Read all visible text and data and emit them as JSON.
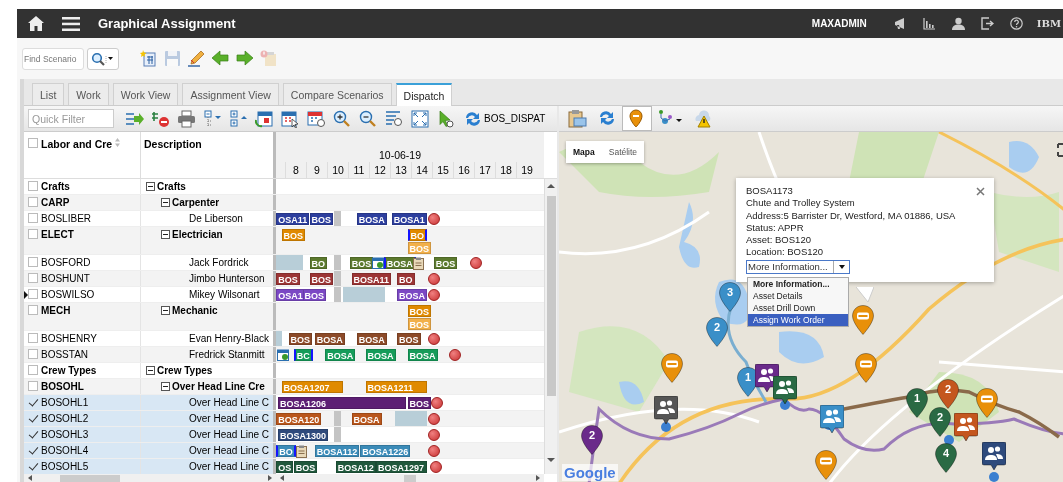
{
  "header": {
    "title": "Graphical Assignment",
    "user": "MAXADMIN",
    "logo": "IBM"
  },
  "toolbar": {
    "search": {
      "placeholder": "Find Scenario"
    },
    "actions": [
      {
        "kind": "new",
        "disabled": false
      },
      {
        "kind": "save",
        "disabled": true
      },
      {
        "kind": "edit",
        "disabled": false
      },
      {
        "kind": "back",
        "disabled": false
      },
      {
        "kind": "forward",
        "disabled": false
      },
      {
        "kind": "alert",
        "disabled": true
      }
    ]
  },
  "tabs": [
    {
      "label": "List",
      "selected": false
    },
    {
      "label": "Work",
      "selected": false
    },
    {
      "label": "Work View",
      "selected": false
    },
    {
      "label": "Assignment View",
      "selected": false
    },
    {
      "label": "Compare Scenarios",
      "selected": false
    },
    {
      "label": "Dispatch",
      "selected": true
    }
  ],
  "dispatch_toolbar": {
    "filter": {
      "placeholder": "Quick Filter"
    },
    "scenario": "BOS_DISPAT"
  },
  "map_toolbar": [
    {
      "kind": "clipboard",
      "selected": false
    },
    {
      "kind": "refresh",
      "selected": false
    },
    {
      "kind": "pin",
      "selected": true
    },
    {
      "kind": "crew",
      "selected": false
    },
    {
      "kind": "weather",
      "selected": false
    }
  ],
  "grid": {
    "all_checked": false,
    "columns": [
      "Labor and Cre",
      "Description"
    ],
    "date": "10-06-19",
    "hours": [
      "8",
      "9",
      "10",
      "11",
      "12",
      "13",
      "14",
      "15",
      "16",
      "17",
      "18",
      "19"
    ],
    "rows": [
      {
        "code": "Crafts",
        "description": "Crafts",
        "checked": false,
        "current": false,
        "expanded": true,
        "children": [
          {
            "code": "CARP",
            "description": "Carpenter",
            "checked": false,
            "current": false,
            "expanded": true,
            "children": [
              {
                "code": "BOSLIBER",
                "description": "De Liberson",
                "checked": false,
                "current": false,
                "bars": [
                  {
                    "kind": "work",
                    "label": "OSA11",
                    "color": "#2d3f9e",
                    "selected": false
                  },
                  {
                    "kind": "work",
                    "label": "BOS",
                    "color": "#2d3f9e",
                    "selected": false
                  },
                  {
                    "kind": "break"
                  },
                  {
                    "kind": "work",
                    "label": "BOSA",
                    "color": "#2d3f9e",
                    "selected": false
                  },
                  {
                    "kind": "work",
                    "label": "BOSA1",
                    "color": "#2d3f9e",
                    "selected": false
                  },
                  {
                    "kind": "alert"
                  }
                ]
              }
            ]
          },
          {
            "code": "ELECT",
            "description": "Electrician",
            "checked": false,
            "current": false,
            "expanded": true,
            "bars": [
              {
                "kind": "work",
                "label": "BOS",
                "color": "#e08a00",
                "selected": false
              },
              {
                "kind": "work",
                "label": "BO",
                "color": "#e08a00",
                "selected": true
              }
            ],
            "second_lane": [
              {
                "kind": "work",
                "label": "BOS",
                "color": "#f2b04a",
                "selected": false
              }
            ],
            "children": [
              {
                "code": "BOSFORD",
                "description": "Jack Fordrick",
                "checked": false,
                "current": false,
                "bars": [
                  {
                    "kind": "unavailable"
                  },
                  {
                    "kind": "work",
                    "label": "BO",
                    "color": "#5c7a2e",
                    "selected": false
                  },
                  {
                    "kind": "break"
                  },
                  {
                    "kind": "work",
                    "label": "BOS",
                    "color": "#5c7a2e",
                    "selected": false
                  },
                  {
                    "kind": "calendar"
                  },
                  {
                    "kind": "work",
                    "label": "BOSA",
                    "color": "#5c7a2e",
                    "selected": true
                  },
                  {
                    "kind": "note"
                  },
                  {
                    "kind": "work",
                    "label": "BOS",
                    "color": "#5c7a2e",
                    "selected": false
                  },
                  {
                    "kind": "alert"
                  }
                ]
              },
              {
                "code": "BOSHUNT",
                "description": "Jimbo Hunterson",
                "checked": false,
                "current": false,
                "bars": [
                  {
                    "kind": "work",
                    "label": "BOS",
                    "color": "#9c3535",
                    "selected": false
                  },
                  {
                    "kind": "work",
                    "label": "BOS",
                    "color": "#9c3535",
                    "selected": false
                  },
                  {
                    "kind": "break"
                  },
                  {
                    "kind": "work",
                    "label": "BOSA11",
                    "color": "#9c3535",
                    "selected": false
                  },
                  {
                    "kind": "work",
                    "label": "BO",
                    "color": "#9c3535",
                    "selected": false
                  },
                  {
                    "kind": "alert"
                  }
                ]
              },
              {
                "code": "BOSWILSO",
                "description": "Mikey Wilsonart",
                "checked": false,
                "current": true,
                "bars": [
                  {
                    "kind": "work",
                    "label": "OSA1",
                    "color": "#7b48c4",
                    "selected": false
                  },
                  {
                    "kind": "work",
                    "label": "BOS",
                    "color": "#7b48c4",
                    "selected": false
                  },
                  {
                    "kind": "break"
                  },
                  {
                    "kind": "unavailable"
                  },
                  {
                    "kind": "work",
                    "label": "BOSA",
                    "color": "#7b48c4",
                    "selected": false
                  },
                  {
                    "kind": "alert"
                  }
                ]
              }
            ]
          },
          {
            "code": "MECH",
            "description": "Mechanic",
            "checked": false,
            "current": false,
            "expanded": true,
            "bars": [
              {
                "kind": "work",
                "label": "BOS",
                "color": "#e08a00",
                "selected": false
              }
            ],
            "second_lane": [
              {
                "kind": "work",
                "label": "BOS",
                "color": "#f2b04a",
                "selected": false
              }
            ],
            "children": [
              {
                "code": "BOSHENRY",
                "description": "Evan Henry-Black",
                "checked": false,
                "current": false,
                "bars": [
                  {
                    "kind": "unavailable"
                  },
                  {
                    "kind": "work",
                    "label": "BOS",
                    "color": "#8c4a28",
                    "selected": false
                  },
                  {
                    "kind": "work",
                    "label": "BOSA",
                    "color": "#8c4a28",
                    "selected": false
                  },
                  {
                    "kind": "work",
                    "label": "BOSA",
                    "color": "#8c4a28",
                    "selected": false
                  },
                  {
                    "kind": "work",
                    "label": "BOS",
                    "color": "#8c4a28",
                    "selected": false
                  },
                  {
                    "kind": "alert"
                  }
                ]
              },
              {
                "code": "BOSSTAN",
                "description": "Fredrick Stanmitt",
                "checked": false,
                "current": false,
                "bars": [
                  {
                    "kind": "calendar"
                  },
                  {
                    "kind": "work",
                    "label": "BC",
                    "color": "#169c5a",
                    "selected": true
                  },
                  {
                    "kind": "work",
                    "label": "BOSA",
                    "color": "#169c5a",
                    "selected": false
                  },
                  {
                    "kind": "work",
                    "label": "BOSA",
                    "color": "#169c5a",
                    "selected": false
                  },
                  {
                    "kind": "work",
                    "label": "BOSA",
                    "color": "#169c5a",
                    "selected": false
                  },
                  {
                    "kind": "alert"
                  }
                ]
              }
            ]
          }
        ]
      },
      {
        "code": "Crew Types",
        "description": "Crew Types",
        "checked": false,
        "current": false,
        "expanded": true,
        "children": [
          {
            "code": "BOSOHL",
            "description": "Over Head Line Cre",
            "checked": false,
            "current": false,
            "expanded": true,
            "bars": [
              {
                "kind": "work",
                "label": "BOSA1207",
                "color": "#e08a00",
                "selected": false
              },
              {
                "kind": "work",
                "label": "BOSA1211",
                "color": "#e08a00",
                "selected": false
              }
            ],
            "children": [
              {
                "code": "BOSOHL1",
                "description": "Over Head Line C",
                "checked": true,
                "current": false,
                "bars": [
                  {
                    "kind": "work",
                    "label": "BOSA1206",
                    "color": "#5d1f74",
                    "selected": false
                  },
                  {
                    "kind": "work",
                    "label": "BOS",
                    "color": "#5d1f74",
                    "selected": false
                  },
                  {
                    "kind": "alert"
                  }
                ]
              },
              {
                "code": "BOSOHL2",
                "description": "Over Head Line C",
                "checked": true,
                "current": false,
                "bars": [
                  {
                    "kind": "work",
                    "label": "BOSA120",
                    "color": "#b9561c",
                    "selected": false
                  },
                  {
                    "kind": "break"
                  },
                  {
                    "kind": "work",
                    "label": "BOSA",
                    "color": "#b9561c",
                    "selected": false
                  },
                  {
                    "kind": "unavailable"
                  },
                  {
                    "kind": "alert"
                  }
                ]
              },
              {
                "code": "BOSOHL3",
                "description": "Over Head Line C",
                "checked": true,
                "current": false,
                "bars": [
                  {
                    "kind": "work",
                    "label": "BOSA1300",
                    "color": "#2e4a7c",
                    "selected": false
                  },
                  {
                    "kind": "break"
                  },
                  {
                    "kind": "alert"
                  }
                ]
              },
              {
                "code": "BOSOHL4",
                "description": "Over Head Line C",
                "checked": true,
                "current": false,
                "bars": [
                  {
                    "kind": "work",
                    "label": "BO",
                    "color": "#3b8bb8",
                    "selected": true
                  },
                  {
                    "kind": "note"
                  },
                  {
                    "kind": "work",
                    "label": "BOSA112",
                    "color": "#3b8bb8",
                    "selected": false
                  },
                  {
                    "kind": "work",
                    "label": "BOSA1226",
                    "color": "#3b8bb8",
                    "selected": false
                  },
                  {
                    "kind": "alert"
                  }
                ]
              },
              {
                "code": "BOSOHL5",
                "description": "Over Head Line C",
                "checked": true,
                "current": false,
                "bars": [
                  {
                    "kind": "work",
                    "label": "OS",
                    "color": "#20583c",
                    "selected": false
                  },
                  {
                    "kind": "work",
                    "label": "BOS",
                    "color": "#20583c",
                    "selected": false
                  },
                  {
                    "kind": "work",
                    "label": "BOSA12",
                    "color": "#20583c",
                    "selected": false
                  },
                  {
                    "kind": "work",
                    "label": "BOSA1297",
                    "color": "#20583c",
                    "selected": false
                  },
                  {
                    "kind": "alert"
                  }
                ]
              }
            ]
          }
        ]
      }
    ]
  },
  "map": {
    "types": [
      {
        "label": "Mapa",
        "selected": true
      },
      {
        "label": "Satélite",
        "selected": false
      }
    ],
    "popup": {
      "title": "BOSA1173",
      "lines": [
        "Chute and Trolley System",
        "Address:5 Barrister Dr, Westford, MA 01886, USA",
        "Status: APPR",
        "Asset: BOS120",
        "Location: BOS120"
      ],
      "dropdown": {
        "value": "More Information...",
        "options": [
          {
            "label": "More Information...",
            "selected": true,
            "highlighted": false
          },
          {
            "label": "Asset Details",
            "selected": false,
            "highlighted": false
          },
          {
            "label": "Asset Drill Down",
            "selected": false,
            "highlighted": false
          },
          {
            "label": "Assign Work Order",
            "selected": false,
            "highlighted": true
          }
        ]
      }
    },
    "markers": [
      {
        "kind": "numbered",
        "label": "3",
        "color": "#3a8fc8"
      },
      {
        "kind": "numbered",
        "label": "2",
        "color": "#3a8fc8"
      },
      {
        "kind": "minus",
        "color": "#e8900a"
      },
      {
        "kind": "numbered",
        "label": "1",
        "color": "#3a8fc8"
      },
      {
        "kind": "crew",
        "color": "#6a2a8a"
      },
      {
        "kind": "crew",
        "color": "#2a6a44"
      },
      {
        "kind": "minus",
        "color": "#e8900a"
      },
      {
        "kind": "minus",
        "color": "#e8900a"
      },
      {
        "kind": "crew",
        "color": "#555555"
      },
      {
        "kind": "numbered",
        "label": "2",
        "color": "#6a2a8a"
      },
      {
        "kind": "crew",
        "color": "#3a8fc8"
      },
      {
        "kind": "numbered",
        "label": "1",
        "color": "#2a6a44"
      },
      {
        "kind": "numbered",
        "label": "2",
        "color": "#c4561e"
      },
      {
        "kind": "numbered",
        "label": "2",
        "color": "#2a6a44"
      },
      {
        "kind": "crew",
        "color": "#c4561e"
      },
      {
        "kind": "minus",
        "color": "#e8900a"
      },
      {
        "kind": "numbered",
        "label": "4",
        "color": "#2a6a44"
      },
      {
        "kind": "crew",
        "color": "#2e4a7c"
      },
      {
        "kind": "minus",
        "color": "#e8900a"
      }
    ],
    "logo": "Google"
  }
}
